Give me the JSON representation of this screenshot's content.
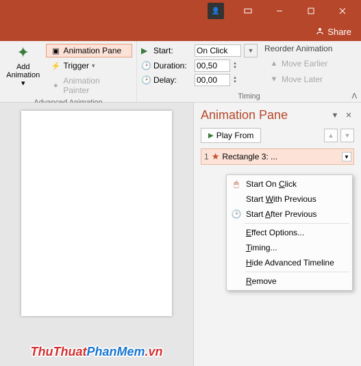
{
  "titlebar": {
    "share_label": "Share"
  },
  "ribbon": {
    "add_animation": {
      "line1": "Add",
      "line2": "Animation"
    },
    "animation_pane": "Animation Pane",
    "trigger": "Trigger",
    "animation_painter": "Animation Painter",
    "advanced_label": "Advanced Animation",
    "start_label": "Start:",
    "start_value": "On Click",
    "duration_label": "Duration:",
    "duration_value": "00,50",
    "delay_label": "Delay:",
    "delay_value": "00,00",
    "reorder_label": "Reorder Animation",
    "move_earlier": "Move Earlier",
    "move_later": "Move Later",
    "timing_label": "Timing"
  },
  "pane": {
    "title": "Animation Pane",
    "play_from": "Play From",
    "item_num": "1",
    "item_name": "Rectangle 3: ..."
  },
  "menu": {
    "start_on_click": "Start On ",
    "start_on_click_u": "C",
    "start_on_click_2": "lick",
    "start_with_prev": "Start ",
    "start_with_prev_u": "W",
    "start_with_prev_2": "ith Previous",
    "start_after_prev": "Start ",
    "start_after_prev_u": "A",
    "start_after_prev_2": "fter Previous",
    "effect_options_u": "E",
    "effect_options": "ffect Options...",
    "timing_u": "T",
    "timing": "iming...",
    "hide_u": "H",
    "hide": "ide Advanced Timeline",
    "remove_u": "R",
    "remove": "emove"
  },
  "watermark": {
    "a": "ThuThuat",
    "b": "PhanMem",
    "c": ".vn"
  }
}
